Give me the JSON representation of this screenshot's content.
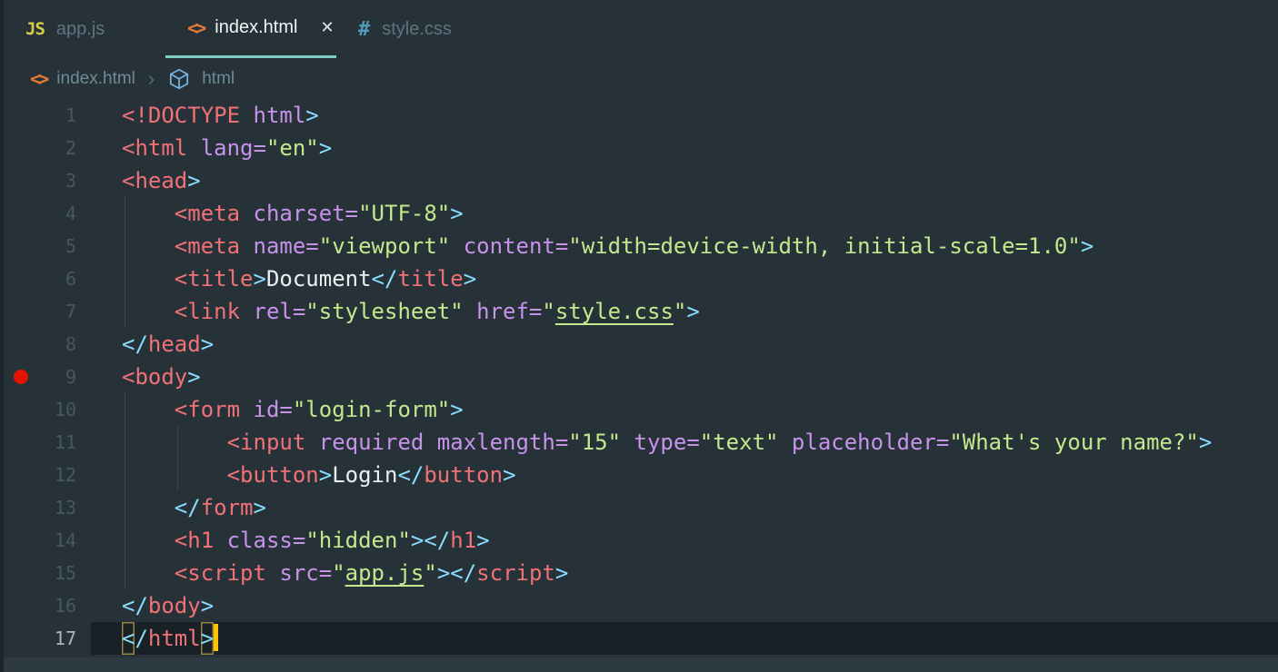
{
  "tabs": [
    {
      "label": "app.js",
      "icon": "js-file-icon",
      "icon_glyph": "JS",
      "active": false
    },
    {
      "label": "index.html",
      "icon": "html-file-icon",
      "icon_glyph": "<>",
      "active": true,
      "close_glyph": "✕"
    },
    {
      "label": "style.css",
      "icon": "css-file-icon",
      "icon_glyph": "#",
      "active": false
    }
  ],
  "breadcrumb": {
    "file_icon_glyph": "<>",
    "file": "index.html",
    "separator": "›",
    "symbol_icon": "cube-icon",
    "symbol": "html"
  },
  "colors": {
    "editor_background": "#263238",
    "current_line_background": "#182226",
    "tab_active_underline": "#80cbc4",
    "tab_inactive_text": "#5c7582",
    "tab_active_text": "#eef4f6",
    "tag": "#f07178",
    "attribute": "#c792ea",
    "string": "#c3e88d",
    "punctuation": "#89ddff",
    "plain_text": "#eceff1",
    "line_number": "#47575f",
    "active_line_number": "#a9b7be",
    "breakpoint": "#e51400",
    "cursor": "#ffc600",
    "js_icon": "#d7ca49",
    "html_icon": "#e37933",
    "css_icon": "#519aba",
    "namespace_icon": "#75b4e3",
    "indent_guide": "#37474f",
    "bottom_band": "#2e3a41"
  },
  "editor": {
    "lines": [
      {
        "num": "1",
        "indent": 0,
        "tokens": [
          [
            "tag",
            "<!DOCTYPE"
          ],
          [
            "attr",
            " html"
          ],
          [
            "punct",
            ">"
          ]
        ]
      },
      {
        "num": "2",
        "indent": 0,
        "tokens": [
          [
            "tag",
            "<html"
          ],
          [
            "attr",
            " lang="
          ],
          [
            "str",
            "\"en\""
          ],
          [
            "punct",
            ">"
          ]
        ]
      },
      {
        "num": "3",
        "indent": 0,
        "tokens": [
          [
            "tag",
            "<head"
          ],
          [
            "punct",
            ">"
          ]
        ]
      },
      {
        "num": "4",
        "indent": 4,
        "tokens": [
          [
            "tag",
            "<meta"
          ],
          [
            "attr",
            " charset="
          ],
          [
            "str",
            "\"UTF-8\""
          ],
          [
            "punct",
            ">"
          ]
        ]
      },
      {
        "num": "5",
        "indent": 4,
        "tokens": [
          [
            "tag",
            "<meta"
          ],
          [
            "attr",
            " name="
          ],
          [
            "str",
            "\"viewport\""
          ],
          [
            "attr",
            " content="
          ],
          [
            "str",
            "\"width=device-width, initial-scale=1.0\""
          ],
          [
            "punct",
            ">"
          ]
        ]
      },
      {
        "num": "6",
        "indent": 4,
        "tokens": [
          [
            "tag",
            "<title"
          ],
          [
            "punct",
            ">"
          ],
          [
            "text",
            "Document"
          ],
          [
            "punct",
            "</"
          ],
          [
            "tag",
            "title"
          ],
          [
            "punct",
            ">"
          ]
        ]
      },
      {
        "num": "7",
        "indent": 4,
        "tokens": [
          [
            "tag",
            "<link"
          ],
          [
            "attr",
            " rel="
          ],
          [
            "str",
            "\"stylesheet\""
          ],
          [
            "attr",
            " href="
          ],
          [
            "str",
            "\""
          ],
          [
            "strlink",
            "style.css"
          ],
          [
            "str",
            "\""
          ],
          [
            "punct",
            ">"
          ]
        ]
      },
      {
        "num": "8",
        "indent": 0,
        "tokens": [
          [
            "punct",
            "</"
          ],
          [
            "tag",
            "head"
          ],
          [
            "punct",
            ">"
          ]
        ]
      },
      {
        "num": "9",
        "indent": 0,
        "breakpoint": true,
        "tokens": [
          [
            "tag",
            "<body"
          ],
          [
            "punct",
            ">"
          ]
        ]
      },
      {
        "num": "10",
        "indent": 4,
        "tokens": [
          [
            "tag",
            "<form"
          ],
          [
            "attr",
            " id="
          ],
          [
            "str",
            "\"login-form\""
          ],
          [
            "punct",
            ">"
          ]
        ]
      },
      {
        "num": "11",
        "indent": 8,
        "tokens": [
          [
            "tag",
            "<input"
          ],
          [
            "attr",
            " required maxlength="
          ],
          [
            "str",
            "\"15\""
          ],
          [
            "attr",
            " type="
          ],
          [
            "str",
            "\"text\""
          ],
          [
            "attr",
            " placeholder="
          ],
          [
            "str",
            "\"What's your name?\""
          ],
          [
            "punct",
            ">"
          ]
        ]
      },
      {
        "num": "12",
        "indent": 8,
        "tokens": [
          [
            "tag",
            "<button"
          ],
          [
            "punct",
            ">"
          ],
          [
            "text",
            "Login"
          ],
          [
            "punct",
            "</"
          ],
          [
            "tag",
            "button"
          ],
          [
            "punct",
            ">"
          ]
        ]
      },
      {
        "num": "13",
        "indent": 4,
        "tokens": [
          [
            "punct",
            "</"
          ],
          [
            "tag",
            "form"
          ],
          [
            "punct",
            ">"
          ]
        ]
      },
      {
        "num": "14",
        "indent": 4,
        "tokens": [
          [
            "tag",
            "<h1"
          ],
          [
            "attr",
            " class="
          ],
          [
            "str",
            "\"hidden\""
          ],
          [
            "punct",
            "></"
          ],
          [
            "tag",
            "h1"
          ],
          [
            "punct",
            ">"
          ]
        ]
      },
      {
        "num": "15",
        "indent": 4,
        "tokens": [
          [
            "tag",
            "<script"
          ],
          [
            "attr",
            " src="
          ],
          [
            "str",
            "\""
          ],
          [
            "strlink",
            "app.js"
          ],
          [
            "str",
            "\""
          ],
          [
            "punct",
            "></"
          ],
          [
            "tag",
            "script"
          ],
          [
            "punct",
            ">"
          ]
        ]
      },
      {
        "num": "16",
        "indent": 0,
        "tokens": [
          [
            "punct",
            "</"
          ],
          [
            "tag",
            "body"
          ],
          [
            "punct",
            ">"
          ]
        ]
      },
      {
        "num": "17",
        "indent": 0,
        "current": true,
        "cursor": true,
        "tokens": [
          [
            "punct-box",
            "<"
          ],
          [
            "punct",
            "/"
          ],
          [
            "tag",
            "html"
          ],
          [
            "punct-box",
            ">"
          ]
        ]
      }
    ]
  }
}
